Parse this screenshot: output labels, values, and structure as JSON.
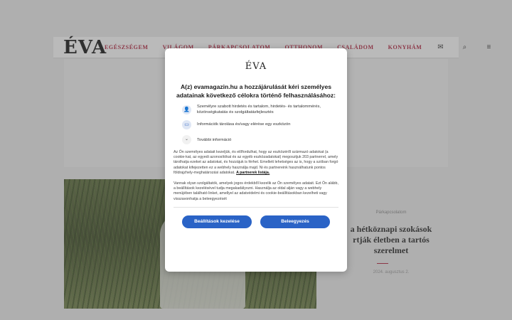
{
  "site": {
    "logo": "ÉVA",
    "nav": [
      "EGÉSZSÉGEM",
      "VILÁGOM",
      "PÁRKAPCSOLATOM",
      "OTTHONOM",
      "CSALÁDOM",
      "KONYHÁM"
    ],
    "icons": [
      "mail-icon",
      "search-icon",
      "menu-icon"
    ]
  },
  "article": {
    "category": "Párkapcsolatom",
    "title": "a hétköznapi szokások\nrtják életben a tartós\nszerelmet",
    "date": "2024. augusztus 2."
  },
  "consent": {
    "logo": "ÉVA",
    "title": "A(z) evamagazin.hu a hozzájárulását kéri személyes adatainak következő célokra történő felhasználásához:",
    "purposes": [
      {
        "icon": "person-icon",
        "text": "Személyre szabott hirdetés és tartalom, hirdetés- és tartalommérés, közönségkutatás és szolgáltatásfejlesztés"
      },
      {
        "icon": "device-icon",
        "text": "Információk tárolása és/vagy elérése egy eszközön"
      }
    ],
    "more_info": "További információ",
    "paragraph1": "Az Ön személyes adatait kezeljük, és előfordulhat, hogy az eszközéről származó adatokat (a cookie-kat, az egyedi azonosítókat és az egyéb eszközadatokat) megosztjuk 203 partnerrel, amely tárolhatja ezeket az adatokat, és hozzájuk is férhet. Emellett lehetséges az is, hogy a szóban forgó adatokat kifejezetten ez a webhely használja majd. Ni és partnereink használhatunk pontos földrajzhely-meghatározási adatokat.",
    "partner_link": "A partnerek listája.",
    "paragraph2": "Vannak olyan szolgáltatók, amelyek jogos érdekből kezelik az Ön személyes adatait. Ezt Ön alább, a beállítások kezelésével tudja megakadályozni. Használja az oldal alján vagy a webhely menüjében található linket, amellyel az adatvédelmi és cookie-beállításokban kezelheti vagy visszavonhatja a beleegyezését",
    "btn_settings": "Beállítások kezelése",
    "btn_accept": "Beleegyezés"
  },
  "colors": {
    "brand": "#b01e3a",
    "button": "#2a63c6"
  }
}
